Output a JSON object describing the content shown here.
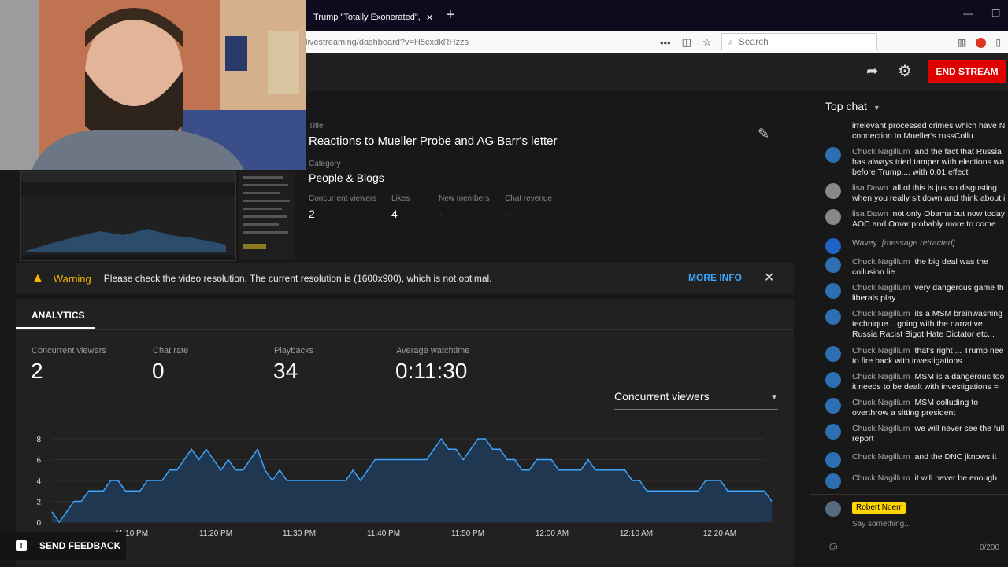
{
  "browser": {
    "tab_title": "Trump \"Totally Exonerated\", Ca",
    "url": "livestreaming/dashboard?v=H5cxdkRHzzs",
    "search_placeholder": "Search"
  },
  "header": {
    "end_stream_label": "END STREAM"
  },
  "stream_info": {
    "title_label": "Title",
    "title": "Reactions to Mueller Probe and AG Barr's letter",
    "category_label": "Category",
    "category": "People & Blogs",
    "stats": [
      {
        "label": "Concurrent viewers",
        "value": "2"
      },
      {
        "label": "Likes",
        "value": "4"
      },
      {
        "label": "New members",
        "value": "-"
      },
      {
        "label": "Chat revenue",
        "value": "-"
      }
    ]
  },
  "warning": {
    "label": "Warning",
    "text": "Please check the video resolution. The current resolution is (1600x900), which is not optimal.",
    "more_info": "MORE INFO"
  },
  "analytics": {
    "tab": "ANALYTICS",
    "stats": [
      {
        "label": "Concurrent viewers",
        "value": "2"
      },
      {
        "label": "Chat rate",
        "value": "0"
      },
      {
        "label": "Playbacks",
        "value": "34"
      },
      {
        "label": "Average watchtime",
        "value": "0:11:30"
      }
    ],
    "dropdown_selected": "Concurrent viewers"
  },
  "chart_data": {
    "type": "area",
    "x_ticks": [
      "11:10 PM",
      "11:20 PM",
      "11:30 PM",
      "11:40 PM",
      "11:50 PM",
      "12:00 AM",
      "12:10 AM",
      "12:20 AM"
    ],
    "y_ticks": [
      "0",
      "2",
      "4",
      "6",
      "8"
    ],
    "ylim": [
      0,
      8
    ],
    "series": [
      {
        "values": [
          1,
          0,
          1,
          2,
          2,
          3,
          3,
          3,
          4,
          4,
          3,
          3,
          3,
          4,
          4,
          4,
          5,
          5,
          6,
          7,
          6,
          7,
          6,
          5,
          6,
          5,
          5,
          6,
          7,
          5,
          4,
          5,
          4,
          4,
          4,
          4,
          4,
          4,
          4,
          4,
          4,
          5,
          4,
          5,
          6,
          6,
          6,
          6,
          6,
          6,
          6,
          6,
          7,
          8,
          7,
          7,
          6,
          7,
          8,
          8,
          7,
          7,
          6,
          6,
          5,
          5,
          6,
          6,
          6,
          5,
          5,
          5,
          5,
          6,
          5,
          5,
          5,
          5,
          5,
          4,
          4,
          3,
          3,
          3,
          3,
          3,
          3,
          3,
          3,
          4,
          4,
          4,
          3,
          3,
          3,
          3,
          3,
          3,
          2
        ]
      }
    ],
    "color": "#3ea6ff"
  },
  "chat": {
    "header": "Top chat",
    "messages": [
      {
        "author": "",
        "text": "irrelevant processed crimes which have N connection to Mueller's russCollu."
      },
      {
        "author": "Chuck Nagillum",
        "text": "and the fact that Russia has always tried tamper with elections wa before Trump.... with 0.01 effect"
      },
      {
        "author": "lisa Dawn",
        "text": "all of this is jus so disgusting when you really sit down and think about i"
      },
      {
        "author": "lisa Dawn",
        "text": "not only Obama but now today AOC and Omar probably more to come ."
      },
      {
        "author": "Wavey",
        "text": "[message retracted]"
      },
      {
        "author": "Chuck Nagillum",
        "text": "the big deal was the collusion lie"
      },
      {
        "author": "Chuck Nagillum",
        "text": "very dangerous game th liberals play"
      },
      {
        "author": "Chuck Nagillum",
        "text": "its a MSM brainwashing technique... going with the narrative... Russia Racist Bigot Hate Dictator etc..."
      },
      {
        "author": "Chuck Nagillum",
        "text": "that's right ... Trump nee to fire back with investigations"
      },
      {
        "author": "Chuck Nagillum",
        "text": "MSM is a dangerous too it needs to be dealt with investigations ="
      },
      {
        "author": "Chuck Nagillum",
        "text": "MSM colluding to overthrow a sitting president"
      },
      {
        "author": "Chuck Nagillum",
        "text": "we will never see the full report"
      },
      {
        "author": "Chuck Nagillum",
        "text": "and the DNC jknows it"
      },
      {
        "author": "Chuck Nagillum",
        "text": "it will never be enough"
      }
    ],
    "user": "Robert Noerr",
    "input_placeholder": "Say something...",
    "char_count": "0/200"
  },
  "feedback_label": "SEND FEEDBACK"
}
